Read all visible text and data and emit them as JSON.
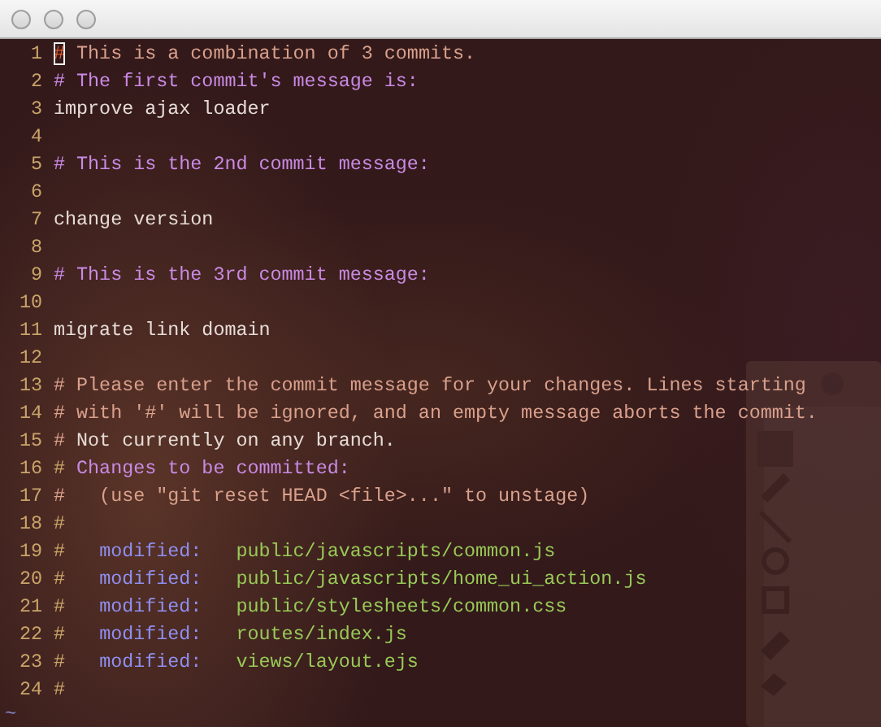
{
  "window": {
    "title_bar": {
      "active": false
    }
  },
  "editor": {
    "lines": [
      {
        "number": "1",
        "cursor": true,
        "segments": [
          {
            "text": "#",
            "kind": "comment"
          },
          {
            "text": " This is a combination of 3 commits.",
            "kind": "comment"
          }
        ]
      },
      {
        "number": "2",
        "cursor": false,
        "segments": [
          {
            "text": "# The first commit's message is:",
            "kind": "heading"
          }
        ]
      },
      {
        "number": "3",
        "cursor": false,
        "segments": [
          {
            "text": "improve ajax loader",
            "kind": "plain"
          }
        ]
      },
      {
        "number": "4",
        "cursor": false
      },
      {
        "number": "5",
        "cursor": false,
        "segments": [
          {
            "text": "# This is the 2nd commit message:",
            "kind": "heading"
          }
        ]
      },
      {
        "number": "6",
        "cursor": false
      },
      {
        "number": "7",
        "cursor": false,
        "segments": [
          {
            "text": "change version",
            "kind": "plain"
          }
        ]
      },
      {
        "number": "8",
        "cursor": false
      },
      {
        "number": "9",
        "cursor": false,
        "segments": [
          {
            "text": "# This is the 3rd commit message:",
            "kind": "heading"
          }
        ]
      },
      {
        "number": "10",
        "cursor": false
      },
      {
        "number": "11",
        "cursor": false,
        "segments": [
          {
            "text": "migrate link domain",
            "kind": "plain"
          }
        ]
      },
      {
        "number": "12",
        "cursor": false
      },
      {
        "number": "13",
        "cursor": false,
        "segments": [
          {
            "text": "# Please enter the commit message for your changes. Lines starting",
            "kind": "comment"
          }
        ]
      },
      {
        "number": "14",
        "cursor": false,
        "segments": [
          {
            "text": "# with '#' will be ignored, and an empty message aborts the commit.",
            "kind": "comment"
          }
        ]
      },
      {
        "number": "15",
        "cursor": false,
        "segments": [
          {
            "text": "# ",
            "kind": "comment"
          },
          {
            "text": "Not currently on any branch.",
            "kind": "plain"
          }
        ]
      },
      {
        "number": "16",
        "cursor": false,
        "segments": [
          {
            "text": "# ",
            "kind": "marker"
          },
          {
            "text": "Changes to be committed:",
            "kind": "heading"
          }
        ]
      },
      {
        "number": "17",
        "cursor": false,
        "segments": [
          {
            "text": "#   (use \"git reset HEAD <file>...\" to unstage)",
            "kind": "comment"
          }
        ]
      },
      {
        "number": "18",
        "cursor": false,
        "segments": [
          {
            "text": "#",
            "kind": "marker"
          }
        ]
      },
      {
        "number": "19",
        "cursor": false,
        "segments": [
          {
            "text": "#   ",
            "kind": "marker"
          },
          {
            "text": "modified:",
            "kind": "label"
          },
          {
            "text": "   public/javascripts/common.js",
            "kind": "path"
          }
        ]
      },
      {
        "number": "20",
        "cursor": false,
        "segments": [
          {
            "text": "#   ",
            "kind": "marker"
          },
          {
            "text": "modified:",
            "kind": "label"
          },
          {
            "text": "   public/javascripts/home_ui_action.js",
            "kind": "path"
          }
        ]
      },
      {
        "number": "21",
        "cursor": false,
        "segments": [
          {
            "text": "#   ",
            "kind": "marker"
          },
          {
            "text": "modified:",
            "kind": "label"
          },
          {
            "text": "   public/stylesheets/common.css",
            "kind": "path"
          }
        ]
      },
      {
        "number": "22",
        "cursor": false,
        "segments": [
          {
            "text": "#   ",
            "kind": "marker"
          },
          {
            "text": "modified:",
            "kind": "label"
          },
          {
            "text": "   routes/index.js",
            "kind": "path"
          }
        ]
      },
      {
        "number": "23",
        "cursor": false,
        "segments": [
          {
            "text": "#   ",
            "kind": "marker"
          },
          {
            "text": "modified:",
            "kind": "label"
          },
          {
            "text": "   views/layout.ejs",
            "kind": "path"
          }
        ]
      },
      {
        "number": "24",
        "cursor": false,
        "segments": [
          {
            "text": "#",
            "kind": "marker"
          }
        ]
      }
    ],
    "filler": "~"
  }
}
